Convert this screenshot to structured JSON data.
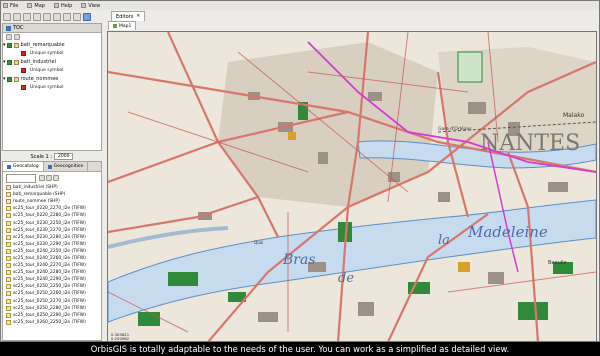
{
  "menubar": {
    "items": [
      {
        "label": "File",
        "icon": "file-icon"
      },
      {
        "label": "Map",
        "icon": "map-icon"
      },
      {
        "label": "Help",
        "icon": "help-icon"
      },
      {
        "label": "View",
        "icon": "view-icon"
      }
    ]
  },
  "toc": {
    "title": "TOC",
    "layers": [
      {
        "label": "bati_remarquable",
        "symbol": "Unique symbol",
        "symbol_color": "#d62828"
      },
      {
        "label": "bati_industriel",
        "symbol": "Unique symbol",
        "symbol_color": "#d62828"
      },
      {
        "label": "route_nommee",
        "symbol": "Unique symbol",
        "symbol_color": "#c0392b"
      }
    ]
  },
  "scale": {
    "label": "Scale 1 :",
    "value": "2000"
  },
  "geocatalog": {
    "tabs": [
      "Geocatalog",
      "Geocognition"
    ],
    "files": [
      "bati_industriel (SHP)",
      "bati_remarquable (SHP)",
      "route_nommee (SHP)",
      "sc25_tour_0220_2270_l2e (TIFW)",
      "sc25_tour_0220_2280_l2e (TIFW)",
      "sc25_tour_0230_2250_l2e (TIFW)",
      "sc25_tour_0230_2270_l2e (TIFW)",
      "sc25_tour_0230_2280_l2e (TIFW)",
      "sc25_tour_0230_2290_l2e (TIFW)",
      "sc25_tour_0240_2250_l2e (TIFW)",
      "sc25_tour_0240_2260_l2e (TIFW)",
      "sc25_tour_0240_2270_l2e (TIFW)",
      "sc25_tour_0240_2280_l2e (TIFW)",
      "sc25_tour_0240_2290_l2e (TIFW)",
      "sc25_tour_0250_2250_l2e (TIFW)",
      "sc25_tour_0250_2260_l2e (TIFW)",
      "sc25_tour_0250_2270_l2e (TIFW)",
      "sc25_tour_0250_2280_l2e (TIFW)",
      "sc25_tour_0250_2290_l2e (TIFW)",
      "sc25_tour_0260_2250_l2e (TIFW)"
    ]
  },
  "editors": {
    "title": "Editors",
    "map_tab": "Map1"
  },
  "map": {
    "labels": {
      "nantes": "NANTES",
      "madeleine": "Madeleine",
      "la": "la",
      "bras": "Bras",
      "de": "de",
      "quai": "Quai",
      "malakoff": "Malako",
      "beaulieu": "Beaulie",
      "gare": "Gare d'Orléans"
    },
    "coords": [
      "0.305821",
      "0.250582"
    ],
    "colors": {
      "river": "#c7dbef",
      "roads": "#d9766a",
      "parks": "#2f8a3a",
      "buildings": "#b9b0a3"
    }
  },
  "caption": "OrbisGIS is totally adaptable to the needs of the user. You can work as a simplified as detailed view."
}
